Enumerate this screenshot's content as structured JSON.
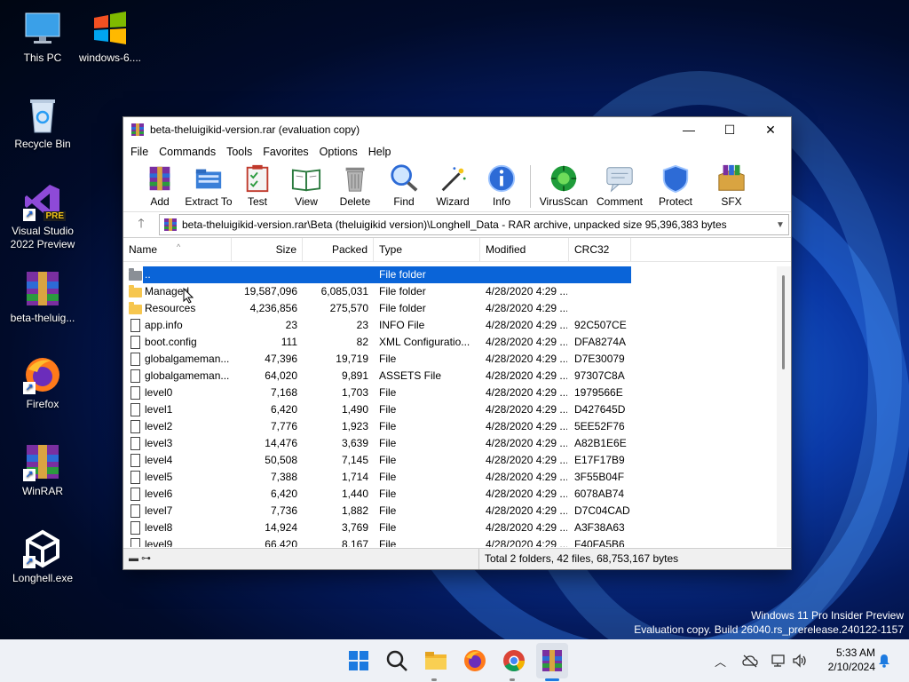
{
  "desktop": {
    "icons": [
      {
        "label": "This PC",
        "icon": "computer-monitor-icon"
      },
      {
        "label": "windows-6....",
        "icon": "windows-logo-icon"
      },
      {
        "label": "Recycle Bin",
        "icon": "recycle-bin-icon"
      },
      {
        "label": "Visual Studio 2022 Preview",
        "icon": "visual-studio-icon",
        "badge": "PRE"
      },
      {
        "label": "beta-theluig...",
        "icon": "winrar-archive-icon"
      },
      {
        "label": "Firefox",
        "icon": "firefox-icon"
      },
      {
        "label": "WinRAR",
        "icon": "winrar-icon"
      },
      {
        "label": "Longhell.exe",
        "icon": "unity-icon"
      }
    ]
  },
  "window": {
    "title": "beta-theluigikid-version.rar (evaluation copy)",
    "controls": {
      "minimize": "—",
      "maximize": "☐",
      "close": "✕"
    },
    "menu": [
      "File",
      "Commands",
      "Tools",
      "Favorites",
      "Options",
      "Help"
    ],
    "toolbar": [
      {
        "label": "Add",
        "icon": "add-archive-icon"
      },
      {
        "label": "Extract To",
        "icon": "extract-folder-icon"
      },
      {
        "label": "Test",
        "icon": "test-clipboard-icon"
      },
      {
        "label": "View",
        "icon": "view-book-icon"
      },
      {
        "label": "Delete",
        "icon": "delete-bin-icon"
      },
      {
        "label": "Find",
        "icon": "find-magnifier-icon"
      },
      {
        "label": "Wizard",
        "icon": "wizard-wand-icon"
      },
      {
        "label": "Info",
        "icon": "info-icon"
      },
      {
        "label": "VirusScan",
        "icon": "virus-scan-icon"
      },
      {
        "label": "Comment",
        "icon": "comment-icon"
      },
      {
        "label": "Protect",
        "icon": "protect-shield-icon"
      },
      {
        "label": "SFX",
        "icon": "sfx-box-icon"
      }
    ],
    "address": "beta-theluigikid-version.rar\\Beta (theluigikid version)\\Longhell_Data - RAR archive, unpacked size 95,396,383 bytes",
    "columns": [
      "Name",
      "Size",
      "Packed",
      "Type",
      "Modified",
      "CRC32"
    ],
    "rows": [
      {
        "name": "..",
        "size": "",
        "packed": "",
        "type": "File folder",
        "modified": "",
        "crc": "",
        "kind": "up"
      },
      {
        "name": "Managed",
        "size": "19,587,096",
        "packed": "6,085,031",
        "type": "File folder",
        "modified": "4/28/2020 4:29 ...",
        "crc": "",
        "kind": "folder"
      },
      {
        "name": "Resources",
        "size": "4,236,856",
        "packed": "275,570",
        "type": "File folder",
        "modified": "4/28/2020 4:29 ...",
        "crc": "",
        "kind": "folder"
      },
      {
        "name": "app.info",
        "size": "23",
        "packed": "23",
        "type": "INFO File",
        "modified": "4/28/2020 4:29 ...",
        "crc": "92C507CE",
        "kind": "file"
      },
      {
        "name": "boot.config",
        "size": "111",
        "packed": "82",
        "type": "XML Configuratio...",
        "modified": "4/28/2020 4:29 ...",
        "crc": "DFA8274A",
        "kind": "file"
      },
      {
        "name": "globalgameman...",
        "size": "47,396",
        "packed": "19,719",
        "type": "File",
        "modified": "4/28/2020 4:29 ...",
        "crc": "D7E30079",
        "kind": "file"
      },
      {
        "name": "globalgameman...",
        "size": "64,020",
        "packed": "9,891",
        "type": "ASSETS File",
        "modified": "4/28/2020 4:29 ...",
        "crc": "97307C8A",
        "kind": "file"
      },
      {
        "name": "level0",
        "size": "7,168",
        "packed": "1,703",
        "type": "File",
        "modified": "4/28/2020 4:29 ...",
        "crc": "1979566E",
        "kind": "file"
      },
      {
        "name": "level1",
        "size": "6,420",
        "packed": "1,490",
        "type": "File",
        "modified": "4/28/2020 4:29 ...",
        "crc": "D427645D",
        "kind": "file"
      },
      {
        "name": "level2",
        "size": "7,776",
        "packed": "1,923",
        "type": "File",
        "modified": "4/28/2020 4:29 ...",
        "crc": "5EE52F76",
        "kind": "file"
      },
      {
        "name": "level3",
        "size": "14,476",
        "packed": "3,639",
        "type": "File",
        "modified": "4/28/2020 4:29 ...",
        "crc": "A82B1E6E",
        "kind": "file"
      },
      {
        "name": "level4",
        "size": "50,508",
        "packed": "7,145",
        "type": "File",
        "modified": "4/28/2020 4:29 ...",
        "crc": "E17F17B9",
        "kind": "file"
      },
      {
        "name": "level5",
        "size": "7,388",
        "packed": "1,714",
        "type": "File",
        "modified": "4/28/2020 4:29 ...",
        "crc": "3F55B04F",
        "kind": "file"
      },
      {
        "name": "level6",
        "size": "6,420",
        "packed": "1,440",
        "type": "File",
        "modified": "4/28/2020 4:29 ...",
        "crc": "6078AB74",
        "kind": "file"
      },
      {
        "name": "level7",
        "size": "7,736",
        "packed": "1,882",
        "type": "File",
        "modified": "4/28/2020 4:29 ...",
        "crc": "D7C04CAD",
        "kind": "file"
      },
      {
        "name": "level8",
        "size": "14,924",
        "packed": "3,769",
        "type": "File",
        "modified": "4/28/2020 4:29 ...",
        "crc": "A3F38A63",
        "kind": "file"
      },
      {
        "name": "level9",
        "size": "66,420",
        "packed": "8,167",
        "type": "File",
        "modified": "4/28/2020 4:29 ...",
        "crc": "F40FA5B6",
        "kind": "file"
      }
    ],
    "status": "Total 2 folders, 42 files, 68,753,167 bytes"
  },
  "watermark": {
    "line1": "Windows 11 Pro Insider Preview",
    "line2": "Evaluation copy. Build 26040.rs_prerelease.240122-1157"
  },
  "taskbar": {
    "apps": [
      "start-icon",
      "search-icon",
      "file-explorer-icon",
      "firefox-icon",
      "chrome-icon",
      "winrar-icon"
    ],
    "time": "5:33 AM",
    "date": "2/10/2024"
  },
  "colors": {
    "selection": "#0a64d8",
    "folder": "#f6c64e",
    "taskbar": "#eef1f6"
  }
}
